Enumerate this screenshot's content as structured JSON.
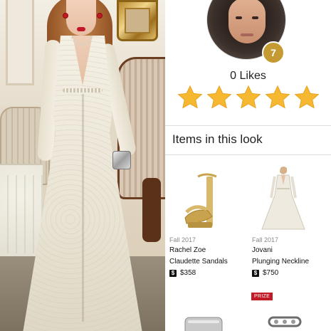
{
  "profile": {
    "level": "7",
    "likes_label": "0 Likes",
    "star_count": 5,
    "star_color": "#f6b731"
  },
  "section": {
    "title": "Items in this look"
  },
  "items": [
    {
      "season": "Fall 2017",
      "brand": "Rachel Zoe",
      "name": "Claudette Sandals",
      "currency": "$",
      "price": "$358",
      "icon": "gold-sandal-icon"
    },
    {
      "season": "Fall 2017",
      "brand": "Jovani",
      "name": "Plunging Neckline",
      "currency": "$",
      "price": "$750",
      "icon": "white-gown-icon"
    }
  ],
  "partial_items": [
    {
      "badge": "PRIZE",
      "icon": "silver-clutch-icon"
    },
    {
      "icon": "silver-ring-icon"
    }
  ],
  "colors": {
    "badge_gold": "#c49a33",
    "prize_red": "#c01b27",
    "divider": "#dedede"
  }
}
